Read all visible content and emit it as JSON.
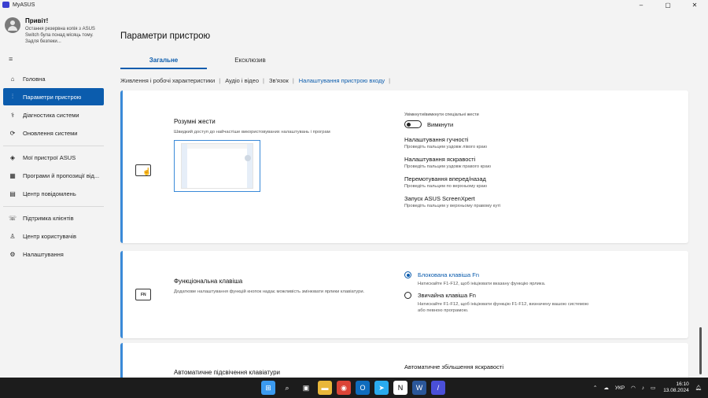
{
  "window": {
    "title": "MyASUS",
    "controls": {
      "minimize": "–",
      "maximize": "▢",
      "close": "✕"
    }
  },
  "sidebar": {
    "greeting": "Привіт!",
    "backup_note": "Остання резервна копія з ASUS Switch була понад місяць тому. Задля безпеки...",
    "groups": [
      [
        {
          "label": "Головна",
          "icon": "home-icon",
          "glyph": "⌂"
        },
        {
          "label": "Параметри пристрою",
          "icon": "sliders-icon",
          "glyph": "⫶",
          "active": true
        },
        {
          "label": "Діагностика системи",
          "icon": "stethoscope-icon",
          "glyph": "⚕"
        },
        {
          "label": "Оновлення системи",
          "icon": "refresh-icon",
          "glyph": "⟳"
        }
      ],
      [
        {
          "label": "Мої пристрої ASUS",
          "icon": "devices-icon",
          "glyph": "◈"
        },
        {
          "label": "Програми й пропозиції від...",
          "icon": "apps-icon",
          "glyph": "▦"
        },
        {
          "label": "Центр повідомлень",
          "icon": "message-icon",
          "glyph": "▤"
        }
      ],
      [
        {
          "label": "Підтримка клієнтів",
          "icon": "support-icon",
          "glyph": "☏"
        },
        {
          "label": "Центр користувачів",
          "icon": "user-icon",
          "glyph": "♙"
        },
        {
          "label": "Налаштування",
          "icon": "gear-icon",
          "glyph": "⚙"
        }
      ]
    ]
  },
  "main": {
    "page_title": "Параметри пристрою",
    "tabs": [
      {
        "label": "Загальне",
        "active": true
      },
      {
        "label": "Ексклюзив"
      }
    ],
    "subtabs": [
      "Живлення і робочі характеристики",
      "Аудіо і відео",
      "Зв'язок",
      "Налаштування пристрою входу"
    ],
    "active_subtab": 3
  },
  "smart_gestures": {
    "title": "Розумні жести",
    "desc": "Швидкий доступ до найчастіше використовуваних налаштувань і програм",
    "toggle_caption": "Увімкнути/вимкнути спеціальні жести",
    "toggle_state": "Вимкнути",
    "gestures": [
      {
        "title": "Налаштування гучності",
        "desc": "Проведіть пальцем уздовж лівого краю"
      },
      {
        "title": "Налаштування яскравості",
        "desc": "Проведіть пальцем уздовж правого краю"
      },
      {
        "title": "Перемотування вперед/назад",
        "desc": "Проведіть пальцем по верхньому краю"
      },
      {
        "title": "Запуск ASUS ScreenXpert",
        "desc": "Проведіть пальцем у верхньому правому куті"
      }
    ]
  },
  "function_key": {
    "title": "Функціональна клавіша",
    "desc": "Додаткове налаштування функцій кнопок надає можливість змінювати ярлики клавіатури.",
    "icon_label": "FN",
    "options": [
      {
        "title": "Блокована клавіша Fn",
        "desc": "Натискайте F1-F12, щоб ініціювати вказану функцію ярлика.",
        "checked": true
      },
      {
        "title": "Звичайна клавіша Fn",
        "desc": "Натискайте F1-F12, щоб ініціювати функцію F1-F12, визначену вашою системою або певною програмою.",
        "checked": false
      }
    ]
  },
  "keyboard": {
    "title": "Автоматичне підсвічення клавіатури",
    "right_title": "Автоматичне збільшення яскравості"
  },
  "taskbar": {
    "language": "УКР",
    "time": "16:10",
    "date": "13.08.2024",
    "apps": [
      {
        "name": "windows-start-icon",
        "glyph": "⊞",
        "color": "#3b9af0"
      },
      {
        "name": "search-icon",
        "glyph": "⌕",
        "color": "#1c1c1c"
      },
      {
        "name": "task-view-icon",
        "glyph": "▣",
        "color": "#1c1c1c"
      },
      {
        "name": "file-explorer-icon",
        "glyph": "▬",
        "color": "#e8b73a"
      },
      {
        "name": "chrome-icon",
        "glyph": "◉",
        "color": "#db4437"
      },
      {
        "name": "outlook-icon",
        "glyph": "O",
        "color": "#0f6cbd"
      },
      {
        "name": "telegram-icon",
        "glyph": "➤",
        "color": "#2aabee"
      },
      {
        "name": "notion-icon",
        "glyph": "N",
        "color": "#ffffff"
      },
      {
        "name": "word-icon",
        "glyph": "W",
        "color": "#2b579a"
      },
      {
        "name": "myasus-icon",
        "glyph": "/",
        "color": "#4a4fd8"
      }
    ]
  }
}
